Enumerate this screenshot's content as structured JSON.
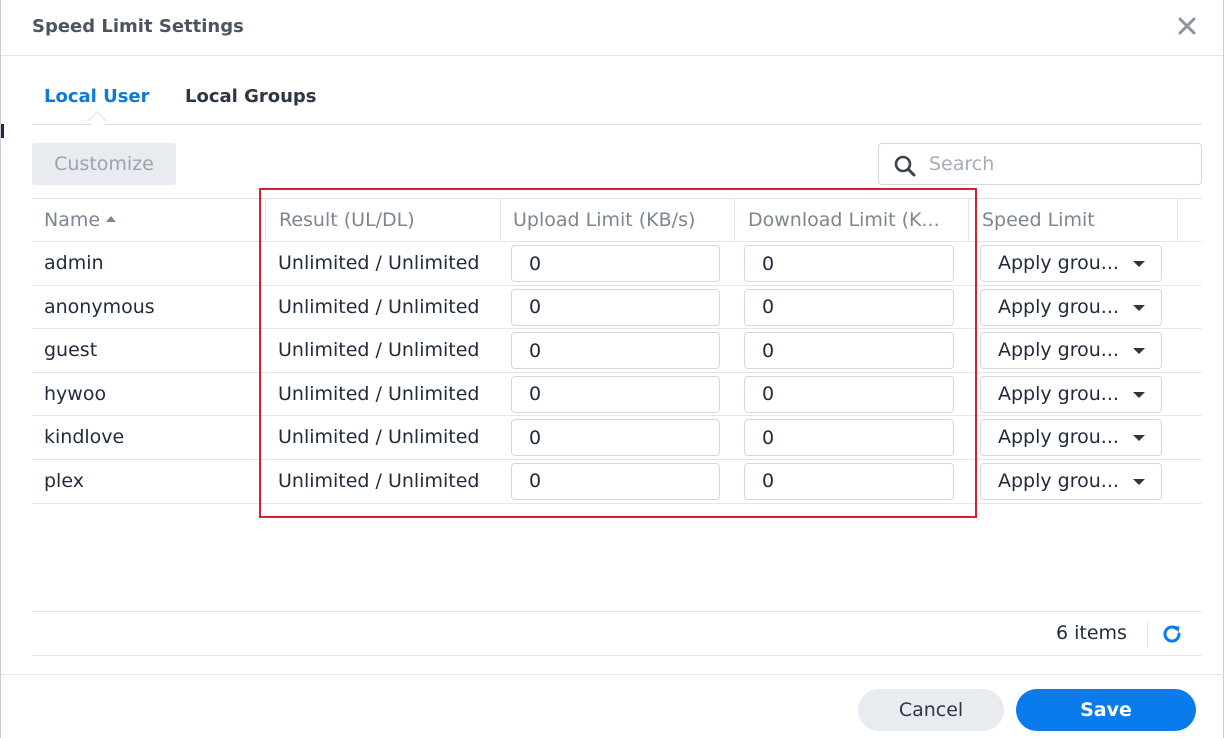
{
  "dialog": {
    "title": "Speed Limit Settings",
    "close_icon": "close-icon"
  },
  "tabs": [
    {
      "label": "Local User",
      "active": true
    },
    {
      "label": "Local Groups",
      "active": false
    }
  ],
  "toolbar": {
    "customize_label": "Customize",
    "search_placeholder": "Search",
    "search_icon": "search-icon"
  },
  "table": {
    "columns": {
      "name": "Name",
      "result": "Result (UL/DL)",
      "upload": "Upload Limit (KB/s)",
      "download": "Download Limit (K...",
      "speed": "Speed Limit"
    },
    "sort": {
      "column": "name",
      "direction": "ascending"
    },
    "rows": [
      {
        "name": "admin",
        "result": "Unlimited / Unlimited",
        "upload": "0",
        "download": "0",
        "speed": "Apply grou..."
      },
      {
        "name": "anonymous",
        "result": "Unlimited / Unlimited",
        "upload": "0",
        "download": "0",
        "speed": "Apply grou..."
      },
      {
        "name": "guest",
        "result": "Unlimited / Unlimited",
        "upload": "0",
        "download": "0",
        "speed": "Apply grou..."
      },
      {
        "name": "hywoo",
        "result": "Unlimited / Unlimited",
        "upload": "0",
        "download": "0",
        "speed": "Apply grou..."
      },
      {
        "name": "kindlove",
        "result": "Unlimited / Unlimited",
        "upload": "0",
        "download": "0",
        "speed": "Apply grou..."
      },
      {
        "name": "plex",
        "result": "Unlimited / Unlimited",
        "upload": "0",
        "download": "0",
        "speed": "Apply grou..."
      }
    ]
  },
  "footer": {
    "items_count": "6 items",
    "refresh_icon": "refresh-icon"
  },
  "buttons": {
    "cancel": "Cancel",
    "save": "Save"
  },
  "colors": {
    "accent": "#0a7bea",
    "active_tab": "#0a7bd7",
    "highlight_box": "#d2232a"
  }
}
